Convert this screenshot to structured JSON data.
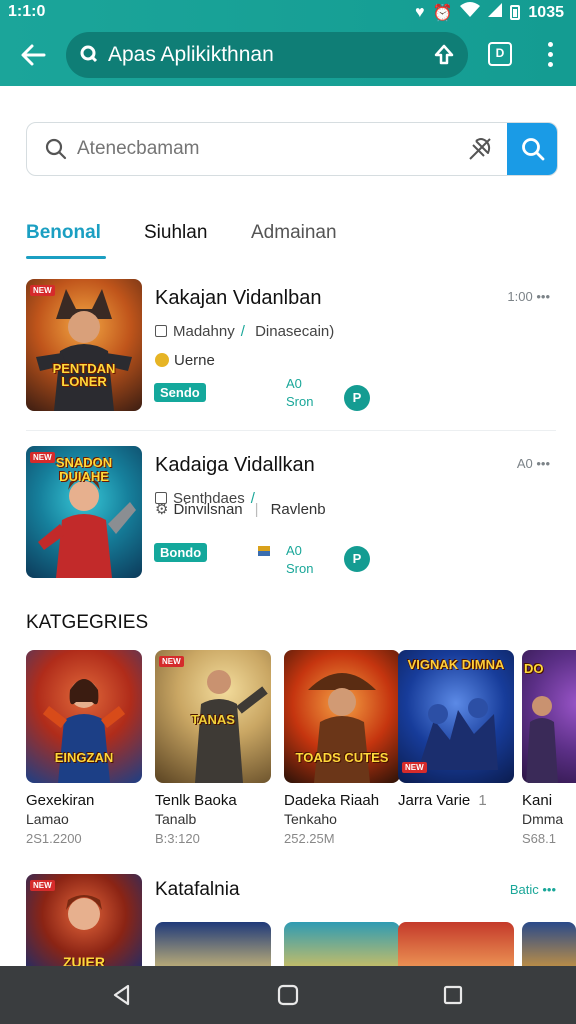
{
  "status": {
    "time": "1:1:0",
    "battery": "1035"
  },
  "appbar": {
    "title": "Apas Aplikikthnan",
    "tabs_count": "D"
  },
  "search": {
    "placeholder": "Atenecbamam"
  },
  "tabs": [
    {
      "label": "Benonal",
      "active": true
    },
    {
      "label": "Siuhlan",
      "active": false
    },
    {
      "label": "Admainan",
      "active": false
    }
  ],
  "apps": [
    {
      "name": "Kakajan Vidanlban",
      "meta": "1:00 •••",
      "thumb_tag": "NEW",
      "thumb_caption": "PENTDAN LONER",
      "sub_label": "Madahny",
      "sub_extra": "Dinasecain)",
      "sub2": "Uerne",
      "pill": "Sendo",
      "size_top": "A0",
      "size_bottom": "Sron",
      "btn": "P"
    },
    {
      "name": "Kadaiga Vidallkan",
      "meta": "A0 •••",
      "thumb_tag": "NEW",
      "thumb_caption": "SNADON DUIAHE",
      "sub_label": "Senthdaes",
      "sub_extra": "",
      "sub2": "Dinvilsnan",
      "sub2_extra": "Ravlenb",
      "pill": "Bondo",
      "size_top": "A0",
      "size_bottom": "Sron",
      "btn": "P"
    }
  ],
  "categories_title": "KATGEGRIES",
  "categories": [
    {
      "name": "Gexekiran",
      "sub": "Lamao",
      "count": "2S1.2200",
      "tag": "",
      "caption": "EINGZAN",
      "colors": [
        "#1c3f86",
        "#d84b19",
        "#f2b531"
      ]
    },
    {
      "name": "Tenlk Baoka",
      "sub": "Tanalb",
      "count": "B:3:120",
      "tag": "NEW",
      "caption": "TANAS",
      "colors": [
        "#7a5a33",
        "#caa764",
        "#3a2a18"
      ]
    },
    {
      "name": "Dadeka Riaah",
      "sub": "Tenkaho",
      "count": "252.25M",
      "tag": "",
      "caption": "TOADS CUTES",
      "colors": [
        "#b8280f",
        "#f0862c",
        "#2a1208"
      ]
    },
    {
      "name": "Jarra Varie",
      "sub": "",
      "count": "",
      "tag": "NEW",
      "caption": "VIGNAK DIMNA",
      "colors": [
        "#173c9a",
        "#5c8ae6",
        "#0b1c4e"
      ],
      "badge": "1"
    },
    {
      "name": "Kani",
      "sub": "Dmma",
      "count": "S68.1",
      "tag": "",
      "caption": "DO",
      "colors": [
        "#5b2f86",
        "#e1a429",
        "#2b1544"
      ]
    }
  ],
  "section2": {
    "title": "Katafalnia",
    "more": "Batic •••",
    "thumb_tag": "NEW",
    "thumb_caption": "ZUIER"
  }
}
